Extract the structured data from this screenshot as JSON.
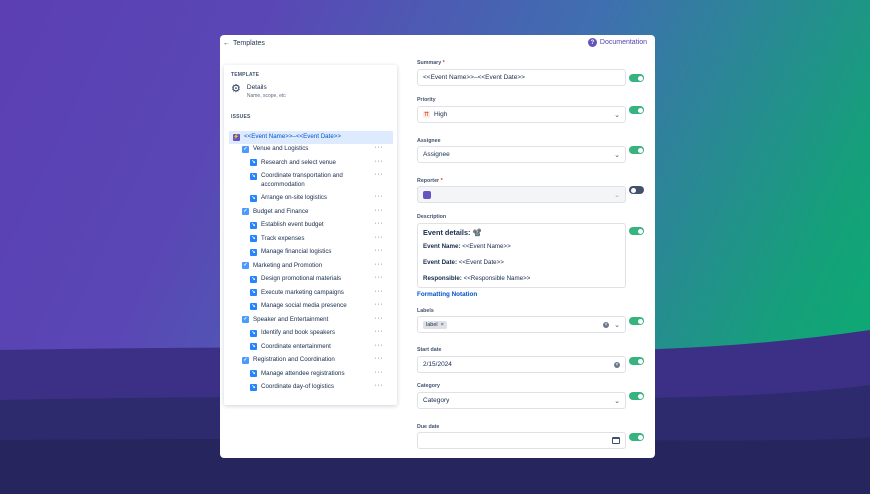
{
  "header": {
    "back_label": "Templates",
    "doc_label": "Documentation"
  },
  "left": {
    "template_label": "TEMPLATE",
    "details_title": "Details",
    "details_subtitle": "Name, scope, etc",
    "issues_label": "ISSUES",
    "epic": "<<Event Name>>–<<Event Date>>",
    "rows": [
      {
        "type": "task",
        "label": "Venue and Logistics"
      },
      {
        "type": "sub",
        "label": "Research and select venue"
      },
      {
        "type": "sub",
        "label": "Coordinate transportation and",
        "label2": "accommodation"
      },
      {
        "type": "sub",
        "label": "Arrange on-site logistics"
      },
      {
        "type": "task",
        "label": "Budget and Finance"
      },
      {
        "type": "sub",
        "label": "Establish event budget"
      },
      {
        "type": "sub",
        "label": "Track expenses"
      },
      {
        "type": "sub",
        "label": "Manage financial logistics"
      },
      {
        "type": "task",
        "label": "Marketing and Promotion"
      },
      {
        "type": "sub",
        "label": "Design promotional materials"
      },
      {
        "type": "sub",
        "label": "Execute marketing campaigns"
      },
      {
        "type": "sub",
        "label": "Manage social media presence"
      },
      {
        "type": "task",
        "label": "Speaker and Entertainment"
      },
      {
        "type": "sub",
        "label": "Identify and book speakers"
      },
      {
        "type": "sub",
        "label": "Coordinate entertainment"
      },
      {
        "type": "task",
        "label": "Registration and Coordination"
      },
      {
        "type": "sub",
        "label": "Manage attendee registrations"
      },
      {
        "type": "sub",
        "label": "Coordinate day-of logistics"
      }
    ],
    "more_label": "···"
  },
  "form": {
    "summary_label": "Summary",
    "summary_value": "<<Event Name>>–<<Event Date>>",
    "priority_label": "Priority",
    "priority_value": "High",
    "assignee_label": "Assignee",
    "assignee_value": "Assignee",
    "reporter_label": "Reporter",
    "description_label": "Description",
    "desc_heading": "Event details: 📽️",
    "desc_name_key": "Event Name:",
    "desc_name_val": " <<Event Name>>",
    "desc_date_key": "Event Date:",
    "desc_date_val": " <<Event Date>>",
    "desc_resp_key": "Responsible:",
    "desc_resp_val": " <<Responsible Name>>",
    "formatting_label": "Formatting Notation",
    "labels_label": "Labels",
    "labels_tag": "label",
    "start_label": "Start date",
    "start_value": "2/15/2024",
    "category_label": "Category",
    "category_value": "Category",
    "due_label": "Due date",
    "required_mark": "*"
  },
  "toggles": {
    "summary": true,
    "priority": true,
    "assignee": true,
    "reporter": false,
    "description": true,
    "labels": true,
    "start": true,
    "category": true,
    "due": true
  },
  "colors": {
    "accent": "#6554c0",
    "link": "#0052cc",
    "toggle_on": "#36b37e"
  }
}
